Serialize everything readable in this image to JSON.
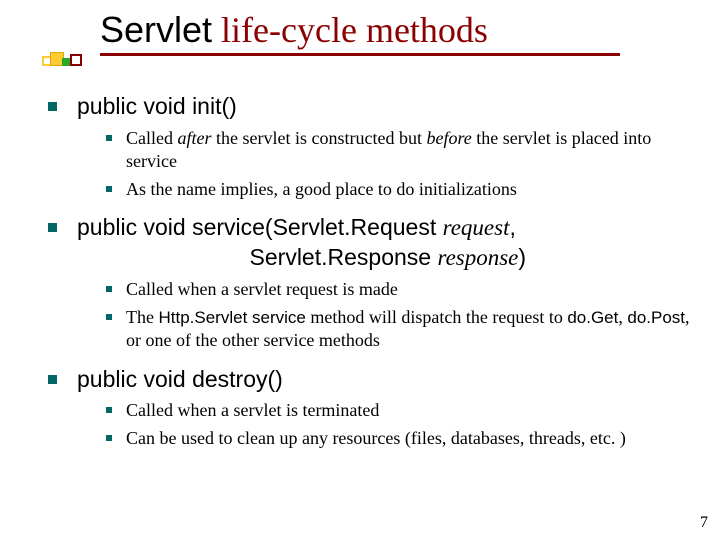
{
  "title": {
    "word1": "Servlet",
    "rest": " life-cycle methods"
  },
  "sections": [
    {
      "heading_html": "public void init()",
      "subs": [
        {
          "html": "Called <i>after</i> the servlet is constructed but <i>before</i> the servlet is placed into service"
        },
        {
          "html": "As the name implies, a good place to do initializations"
        }
      ]
    },
    {
      "heading_html": "public void service(Servlet.Request <span class='ital'>request</span>,<br>&nbsp;&nbsp;&nbsp;&nbsp;&nbsp;&nbsp;&nbsp;&nbsp;&nbsp;&nbsp;&nbsp;&nbsp;&nbsp;&nbsp;&nbsp;&nbsp;&nbsp;&nbsp;&nbsp;&nbsp;&nbsp;&nbsp;&nbsp;&nbsp;&nbsp;&nbsp;&nbsp;Servlet.Response <span class='ital'>response</span>)",
      "subs": [
        {
          "html": "Called when a servlet request is made"
        },
        {
          "html": "The <span class='code'>Http.Servlet service</span> method will dispatch the request to <span class='code'>do.Get</span>, <span class='code'>do.Post</span>, or one of the other service methods"
        }
      ]
    },
    {
      "heading_html": "public void destroy()",
      "subs": [
        {
          "html": "Called when a servlet is terminated"
        },
        {
          "html": "Can be used to clean up any resources (files, databases, threads, etc. )"
        }
      ]
    }
  ],
  "page_number": "7"
}
